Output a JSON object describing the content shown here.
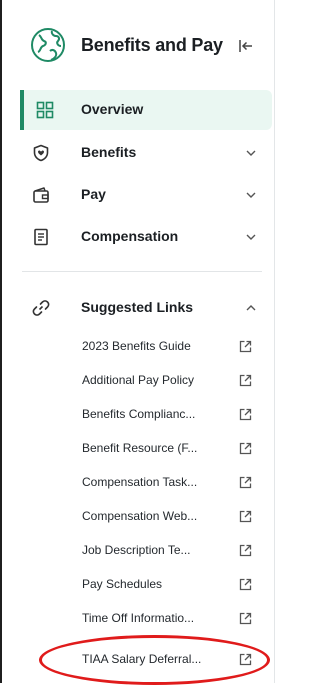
{
  "app": {
    "title": "Benefits and Pay"
  },
  "nav": [
    {
      "label": "Overview",
      "icon": "grid-icon",
      "active": true
    },
    {
      "label": "Benefits",
      "icon": "shield-heart-icon"
    },
    {
      "label": "Pay",
      "icon": "wallet-icon"
    },
    {
      "label": "Compensation",
      "icon": "document-icon"
    }
  ],
  "suggested": {
    "label": "Suggested Links",
    "links": [
      "2023 Benefits Guide",
      "Additional Pay Policy",
      "Benefits Complianc...",
      "Benefit Resource (F...",
      "Compensation Task...",
      "Compensation Web...",
      "Job Description Te...",
      "Pay Schedules",
      "Time Off Informatio...",
      "TIAA Salary Deferral..."
    ]
  },
  "colors": {
    "accent": "#1f8a65",
    "active_bg": "#eaf7f2",
    "annotation": "#e01b1b"
  }
}
